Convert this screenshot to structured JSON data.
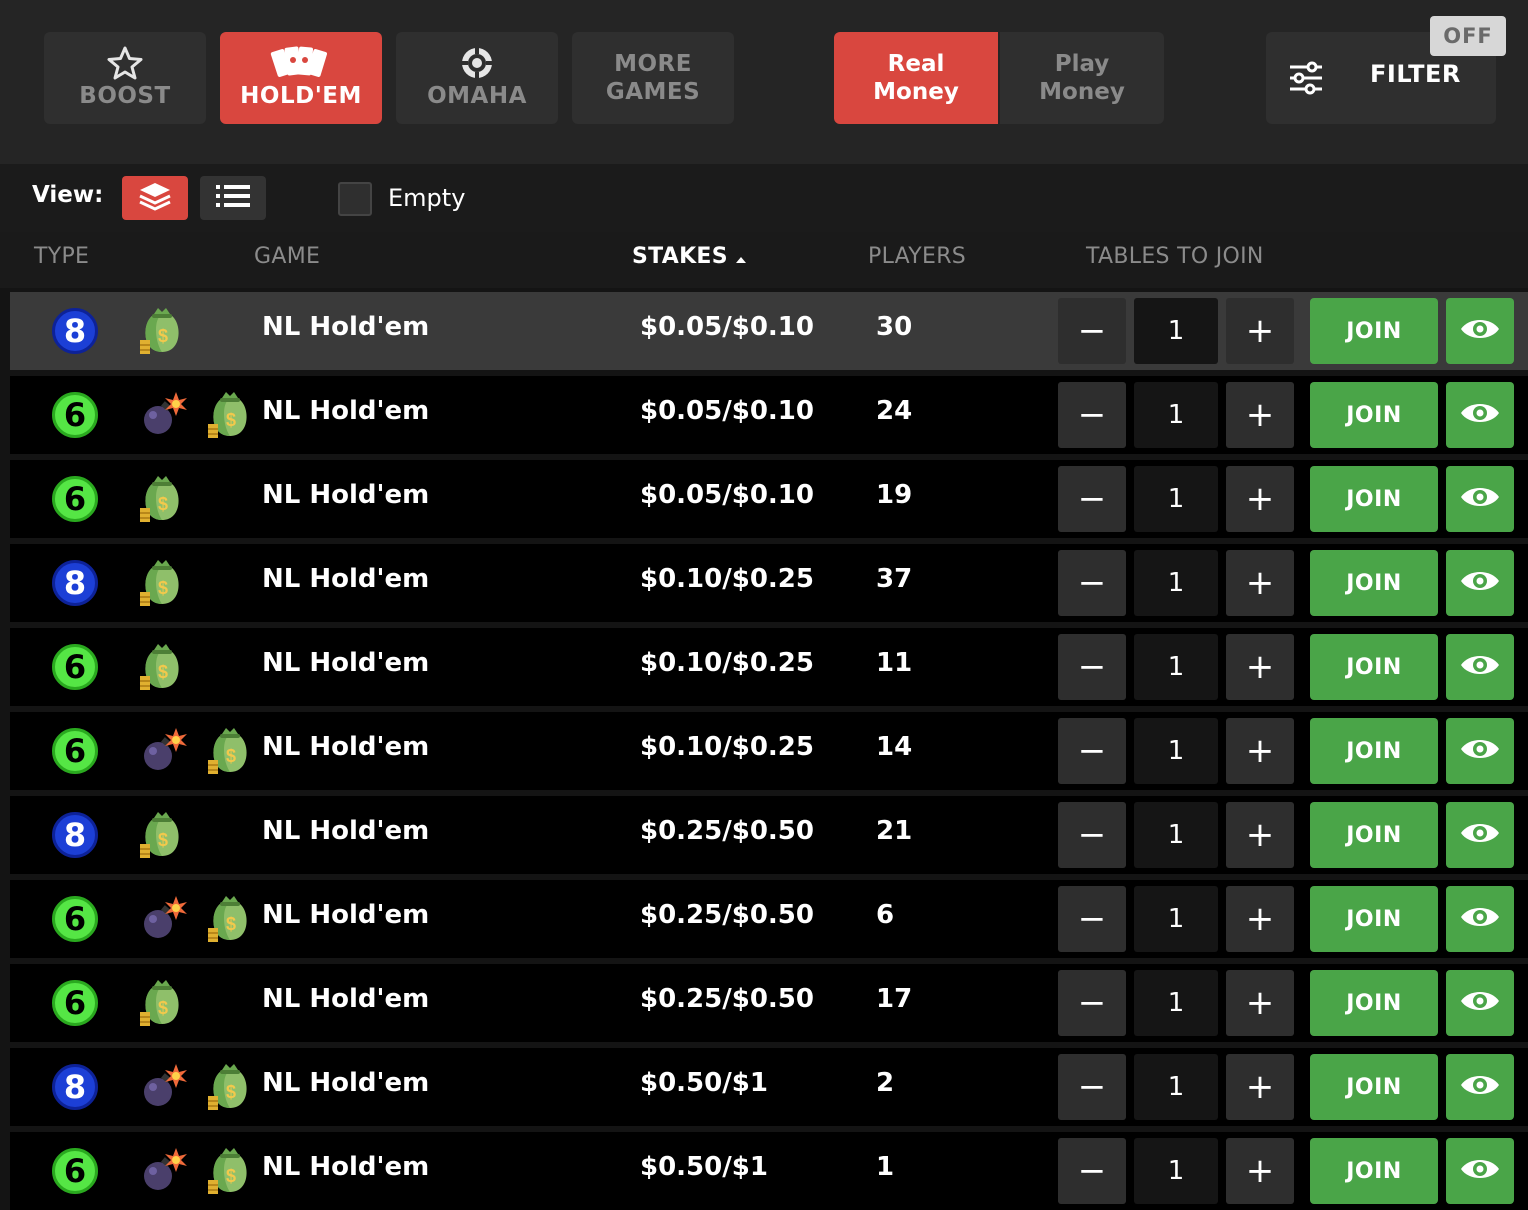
{
  "game_tabs": [
    {
      "label": "BOOST",
      "icon": "star-icon",
      "active": false
    },
    {
      "label": "HOLD'EM",
      "icon": "cards-icon",
      "active": true
    },
    {
      "label": "OMAHA",
      "icon": "poker-chip-icon",
      "active": false
    },
    {
      "label": "MORE\nGAMES",
      "icon": "",
      "active": false
    }
  ],
  "money_toggle": {
    "real": "Real\nMoney",
    "play": "Play\nMoney",
    "active": "real"
  },
  "filter": {
    "label": "FILTER",
    "status": "OFF",
    "icon": "sliders-icon"
  },
  "view": {
    "label": "View:",
    "modes": [
      "stacked-cards-icon",
      "list-icon"
    ],
    "active": "stacked-cards-icon"
  },
  "empty_checkbox": {
    "label": "Empty",
    "checked": false
  },
  "columns": {
    "type": "TYPE",
    "game": "GAME",
    "stakes": "STAKES",
    "players": "PLAYERS",
    "tables": "TABLES TO JOIN",
    "sorted_by": "stakes",
    "sort_dir": "asc"
  },
  "colors": {
    "accent": "#d9473f",
    "join": "#4aa548",
    "seat8": "#1c3fd6",
    "seat6": "#55e645"
  },
  "rows": [
    {
      "seats": "8",
      "bomb": false,
      "game": "NL Hold'em",
      "stakes": "$0.05/$0.10",
      "players": "30",
      "tables": "1",
      "join": "JOIN",
      "minus": "−",
      "plus": "+",
      "highlight": true
    },
    {
      "seats": "6",
      "bomb": true,
      "game": "NL Hold'em",
      "stakes": "$0.05/$0.10",
      "players": "24",
      "tables": "1",
      "join": "JOIN",
      "minus": "−",
      "plus": "+"
    },
    {
      "seats": "6",
      "bomb": false,
      "game": "NL Hold'em",
      "stakes": "$0.05/$0.10",
      "players": "19",
      "tables": "1",
      "join": "JOIN",
      "minus": "−",
      "plus": "+"
    },
    {
      "seats": "8",
      "bomb": false,
      "game": "NL Hold'em",
      "stakes": "$0.10/$0.25",
      "players": "37",
      "tables": "1",
      "join": "JOIN",
      "minus": "−",
      "plus": "+"
    },
    {
      "seats": "6",
      "bomb": false,
      "game": "NL Hold'em",
      "stakes": "$0.10/$0.25",
      "players": "11",
      "tables": "1",
      "join": "JOIN",
      "minus": "−",
      "plus": "+"
    },
    {
      "seats": "6",
      "bomb": true,
      "game": "NL Hold'em",
      "stakes": "$0.10/$0.25",
      "players": "14",
      "tables": "1",
      "join": "JOIN",
      "minus": "−",
      "plus": "+"
    },
    {
      "seats": "8",
      "bomb": false,
      "game": "NL Hold'em",
      "stakes": "$0.25/$0.50",
      "players": "21",
      "tables": "1",
      "join": "JOIN",
      "minus": "−",
      "plus": "+"
    },
    {
      "seats": "6",
      "bomb": true,
      "game": "NL Hold'em",
      "stakes": "$0.25/$0.50",
      "players": "6",
      "tables": "1",
      "join": "JOIN",
      "minus": "−",
      "plus": "+"
    },
    {
      "seats": "6",
      "bomb": false,
      "game": "NL Hold'em",
      "stakes": "$0.25/$0.50",
      "players": "17",
      "tables": "1",
      "join": "JOIN",
      "minus": "−",
      "plus": "+"
    },
    {
      "seats": "8",
      "bomb": true,
      "game": "NL Hold'em",
      "stakes": "$0.50/$1",
      "players": "2",
      "tables": "1",
      "join": "JOIN",
      "minus": "−",
      "plus": "+"
    },
    {
      "seats": "6",
      "bomb": true,
      "game": "NL Hold'em",
      "stakes": "$0.50/$1",
      "players": "1",
      "tables": "1",
      "join": "JOIN",
      "minus": "−",
      "plus": "+"
    }
  ]
}
